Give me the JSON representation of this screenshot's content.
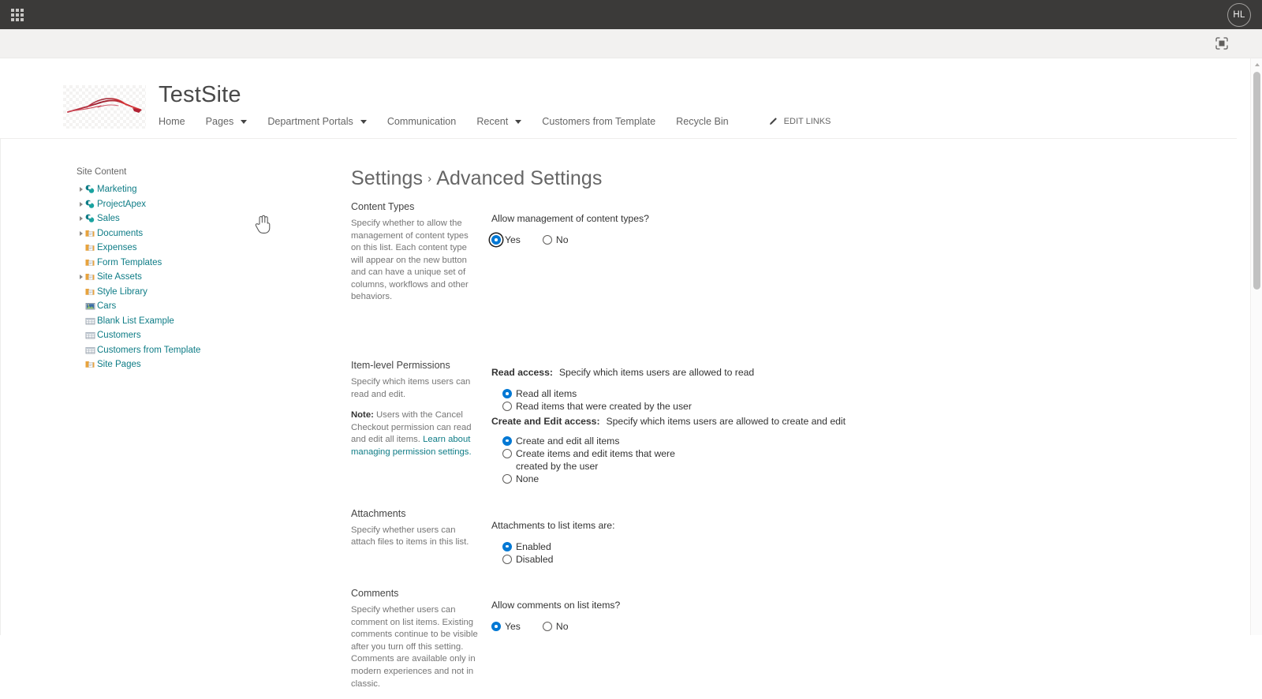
{
  "suite": {
    "waffle_label": "App launcher",
    "avatar_initials": "HL",
    "focus_icon": "focus-mode-icon"
  },
  "site_header": {
    "title": "TestSite",
    "logo_alt": "car-silhouette-logo",
    "nav": [
      {
        "label": "Home",
        "has_caret": false
      },
      {
        "label": "Pages",
        "has_caret": true
      },
      {
        "label": "Department Portals",
        "has_caret": true
      },
      {
        "label": "Communication",
        "has_caret": false
      },
      {
        "label": "Recent",
        "has_caret": true
      },
      {
        "label": "Customers from Template",
        "has_caret": false
      },
      {
        "label": "Recycle Bin",
        "has_caret": false
      }
    ],
    "edit_links_label": "EDIT LINKS"
  },
  "tree": {
    "title": "Site Content",
    "items": [
      {
        "label": "Marketing",
        "icon": "sharepoint-site-icon",
        "expandable": true
      },
      {
        "label": "ProjectApex",
        "icon": "sharepoint-site-icon",
        "expandable": true
      },
      {
        "label": "Sales",
        "icon": "sharepoint-site-icon",
        "expandable": true
      },
      {
        "label": "Documents",
        "icon": "document-library-icon",
        "expandable": true
      },
      {
        "label": "Expenses",
        "icon": "document-library-icon",
        "expandable": false
      },
      {
        "label": "Form Templates",
        "icon": "document-library-icon",
        "expandable": false
      },
      {
        "label": "Site Assets",
        "icon": "document-library-icon",
        "expandable": true
      },
      {
        "label": "Style Library",
        "icon": "document-library-icon",
        "expandable": false
      },
      {
        "label": "Cars",
        "icon": "picture-library-icon",
        "expandable": false
      },
      {
        "label": "Blank List Example",
        "icon": "list-icon",
        "expandable": false
      },
      {
        "label": "Customers",
        "icon": "list-icon",
        "expandable": false
      },
      {
        "label": "Customers from Template",
        "icon": "list-icon",
        "expandable": false
      },
      {
        "label": "Site Pages",
        "icon": "document-library-icon",
        "expandable": false
      }
    ]
  },
  "page": {
    "breadcrumb_parent": "Settings",
    "breadcrumb_sep": "›",
    "breadcrumb_current": "Advanced Settings"
  },
  "sections": {
    "content_types": {
      "heading": "Content Types",
      "description": "Specify whether to allow the management of content types on this list. Each content type will appear on the new button and can have a unique set of columns, workflows and other behaviors.",
      "question": "Allow management of content types?",
      "option_yes": "Yes",
      "option_no": "No",
      "selected": "Yes"
    },
    "item_level_permissions": {
      "heading": "Item-level Permissions",
      "description": "Specify which items users can read and edit.",
      "note_label": "Note:",
      "note_text": "Users with the Cancel Checkout permission can read and edit all items.",
      "note_link": "Learn about managing permission settings.",
      "read_access_label": "Read access:",
      "read_access_desc": "Specify which items users are allowed to read",
      "read_options": [
        "Read all items",
        "Read items that were created by the user"
      ],
      "read_selected": "Read all items",
      "create_edit_label": "Create and Edit access:",
      "create_edit_desc": "Specify which items users are allowed to create and edit",
      "create_options": [
        "Create and edit all items",
        "Create items and edit items that were created by the user",
        "None"
      ],
      "create_selected": "Create and edit all items"
    },
    "attachments": {
      "heading": "Attachments",
      "description": "Specify whether users can attach files to items in this list.",
      "question": "Attachments to list items are:",
      "options": [
        "Enabled",
        "Disabled"
      ],
      "selected": "Enabled"
    },
    "comments": {
      "heading": "Comments",
      "description": "Specify whether users can comment on list items. Existing comments continue to be visible after you turn off this setting. Comments are available only in modern experiences and not in classic.",
      "question": "Allow comments on list items?",
      "option_yes": "Yes",
      "option_no": "No",
      "selected": "Yes"
    }
  },
  "colors": {
    "suite_bar": "#3b3a39",
    "accent_blue": "#0078d4",
    "link_teal": "#0e7c86",
    "text_dark": "#333333",
    "text_muted": "#767676"
  }
}
